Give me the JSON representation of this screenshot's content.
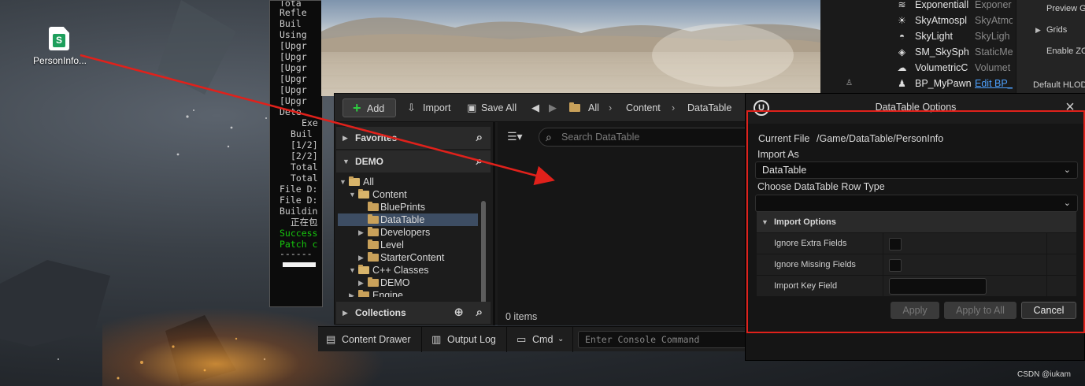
{
  "desktop": {
    "file_icon": {
      "label": "PersonInfo...",
      "badge": "S",
      "icon": "spreadsheet-file-icon"
    }
  },
  "console": {
    "lines": [
      "Tota",
      "Refle",
      "Buil",
      "Using",
      "[Upgr",
      "[Upgr",
      "[Upgr",
      "[Upgr",
      "[Upgr",
      "[Upgr",
      "Dete",
      "Exe",
      "Buil",
      "[1/2]",
      "[2/2]",
      "Total",
      "Total",
      "File D:",
      "File D:",
      "Buildin",
      "正在包",
      "Success",
      "Patch c",
      "------"
    ]
  },
  "outliner": {
    "rows": [
      {
        "name": "Exponentiall",
        "type": "Exponer",
        "icon": "fog-icon"
      },
      {
        "name": "SkyAtmospl",
        "type": "SkyAtmo",
        "icon": "sky-atmosphere-icon"
      },
      {
        "name": "SkyLight",
        "type": "SkyLigh",
        "icon": "sky-light-icon"
      },
      {
        "name": "SM_SkySph",
        "type": "StaticMe",
        "icon": "static-mesh-icon"
      },
      {
        "name": "VolumetricC",
        "type": "Volumet",
        "icon": "volumetric-cloud-icon"
      },
      {
        "name": "BP_MyPawn",
        "type": "Edit BP_",
        "icon": "pawn-icon"
      }
    ]
  },
  "details": {
    "rows": [
      "Preview G",
      "Grids",
      "Enable ZC"
    ],
    "lod_label": "Default HLOD"
  },
  "content_browser": {
    "toolbar": {
      "add_label": "Add",
      "import_label": "Import",
      "save_all_label": "Save All",
      "path": [
        "All",
        "Content",
        "DataTable"
      ]
    },
    "favorites_label": "Favorites",
    "project_label": "DEMO",
    "collections_label": "Collections",
    "tree": [
      "All",
      "Content",
      "BluePrints",
      "DataTable",
      "Developers",
      "Level",
      "StarterContent",
      "C++ Classes",
      "DEMO",
      "Engine"
    ],
    "selected": "DataTable",
    "search_placeholder": "Search DataTable",
    "item_count": "0 items"
  },
  "statusbar": {
    "content_drawer": "Content Drawer",
    "output_log": "Output Log",
    "cmd": "Cmd",
    "console_placeholder": "Enter Console Command"
  },
  "dialog": {
    "title": "DataTable Options",
    "current_file_label": "Current File",
    "current_file_value": "/Game/DataTable/PersonInfo",
    "import_as_label": "Import As",
    "import_as_value": "DataTable",
    "row_type_label": "Choose DataTable Row Type",
    "row_type_value": "",
    "import_options_label": "Import Options",
    "options": {
      "ignore_extra": "Ignore Extra Fields",
      "ignore_missing": "Ignore Missing Fields",
      "import_key": "Import Key Field"
    },
    "buttons": {
      "apply": "Apply",
      "apply_all": "Apply to All",
      "cancel": "Cancel"
    },
    "highlight_color": "#e0211b"
  },
  "watermark": "CSDN @iukam",
  "annotation_arrow_color": "#e0211b"
}
